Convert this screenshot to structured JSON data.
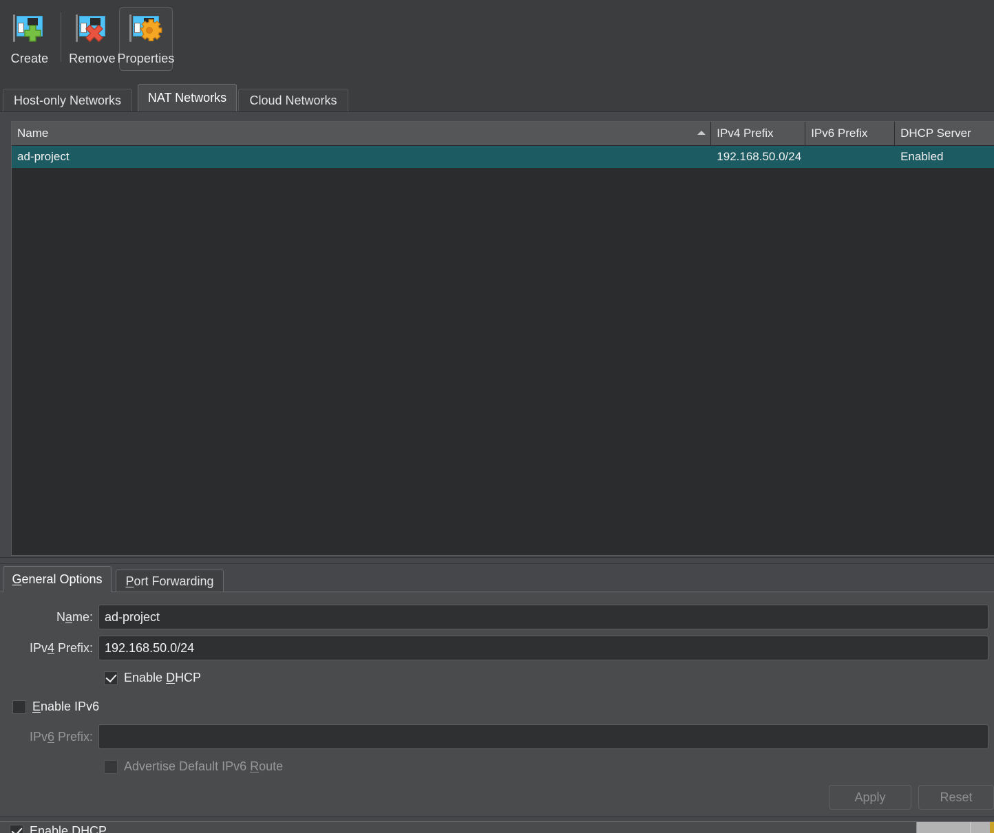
{
  "toolbar": {
    "buttons": [
      {
        "label": "Create",
        "icon": "network-add-icon",
        "active": false
      },
      {
        "label": "Remove",
        "icon": "network-remove-icon",
        "active": false
      },
      {
        "label": "Properties",
        "icon": "network-properties-icon",
        "active": true
      }
    ]
  },
  "top_tabs": [
    {
      "label": "Host-only Networks",
      "selected": false
    },
    {
      "label": "NAT Networks",
      "selected": true
    },
    {
      "label": "Cloud Networks",
      "selected": false
    }
  ],
  "table": {
    "columns": [
      {
        "label": "Name",
        "sorted": true,
        "sort_direction": "ascending"
      },
      {
        "label": "IPv4 Prefix",
        "sorted": false,
        "sort_direction": ""
      },
      {
        "label": "IPv6 Prefix",
        "sorted": false,
        "sort_direction": ""
      },
      {
        "label": "DHCP Server",
        "sorted": false,
        "sort_direction": ""
      }
    ],
    "rows": [
      {
        "selected": true,
        "name": "ad-project",
        "ipv4_prefix": "192.168.50.0/24",
        "ipv6_prefix": "",
        "dhcp_server": "Enabled"
      }
    ]
  },
  "bottom_tabs": [
    {
      "label_pre": "",
      "mnemonic": "G",
      "label_post": "eneral Options",
      "selected": true
    },
    {
      "label_pre": "",
      "mnemonic": "P",
      "label_post": "ort Forwarding",
      "selected": false
    }
  ],
  "general_options": {
    "name_label_pre": "N",
    "name_label_mn": "a",
    "name_label_post": "me:",
    "name_value": "ad-project",
    "ipv4_label_pre": "IPv",
    "ipv4_label_mn": "4",
    "ipv4_label_post": " Prefix:",
    "ipv4_value": "192.168.50.0/24",
    "enable_dhcp_pre": "Enable ",
    "enable_dhcp_mn": "D",
    "enable_dhcp_post": "HCP",
    "enable_dhcp_checked": true,
    "enable_ipv6_pre": "",
    "enable_ipv6_mn": "E",
    "enable_ipv6_post": "nable IPv6",
    "enable_ipv6_checked": false,
    "ipv6_label_pre": "IPv",
    "ipv6_label_mn": "6",
    "ipv6_label_post": " Prefix:",
    "ipv6_value": "",
    "ipv6_disabled": true,
    "advertise_pre": "Advertise Default IPv6 ",
    "advertise_mn": "R",
    "advertise_post": "oute",
    "advertise_checked": false,
    "advertise_disabled": true,
    "apply_label": "Apply",
    "apply_disabled": true,
    "reset_label": "Reset",
    "reset_disabled": true
  },
  "overflow": {
    "enable_dhcp_pre": "Enable ",
    "enable_dhcp_mn": "D",
    "enable_dhcp_post": "HCP",
    "enable_dhcp_checked": true
  },
  "colors": {
    "window_bg": "#46474a",
    "toolbar_bg": "#3c3d3f",
    "panel_bg": "#4a4b4d",
    "table_bg": "#2b2c2e",
    "header_bg": "#555658",
    "selection": "#1d5b63",
    "input_bg": "#2f3032",
    "text": "#f0f0f0",
    "text_disabled": "#97989a",
    "nic_blue": "#4fc3f7",
    "create_green": "#76c043",
    "remove_red": "#e8543f",
    "gear_orange": "#f5a623"
  }
}
